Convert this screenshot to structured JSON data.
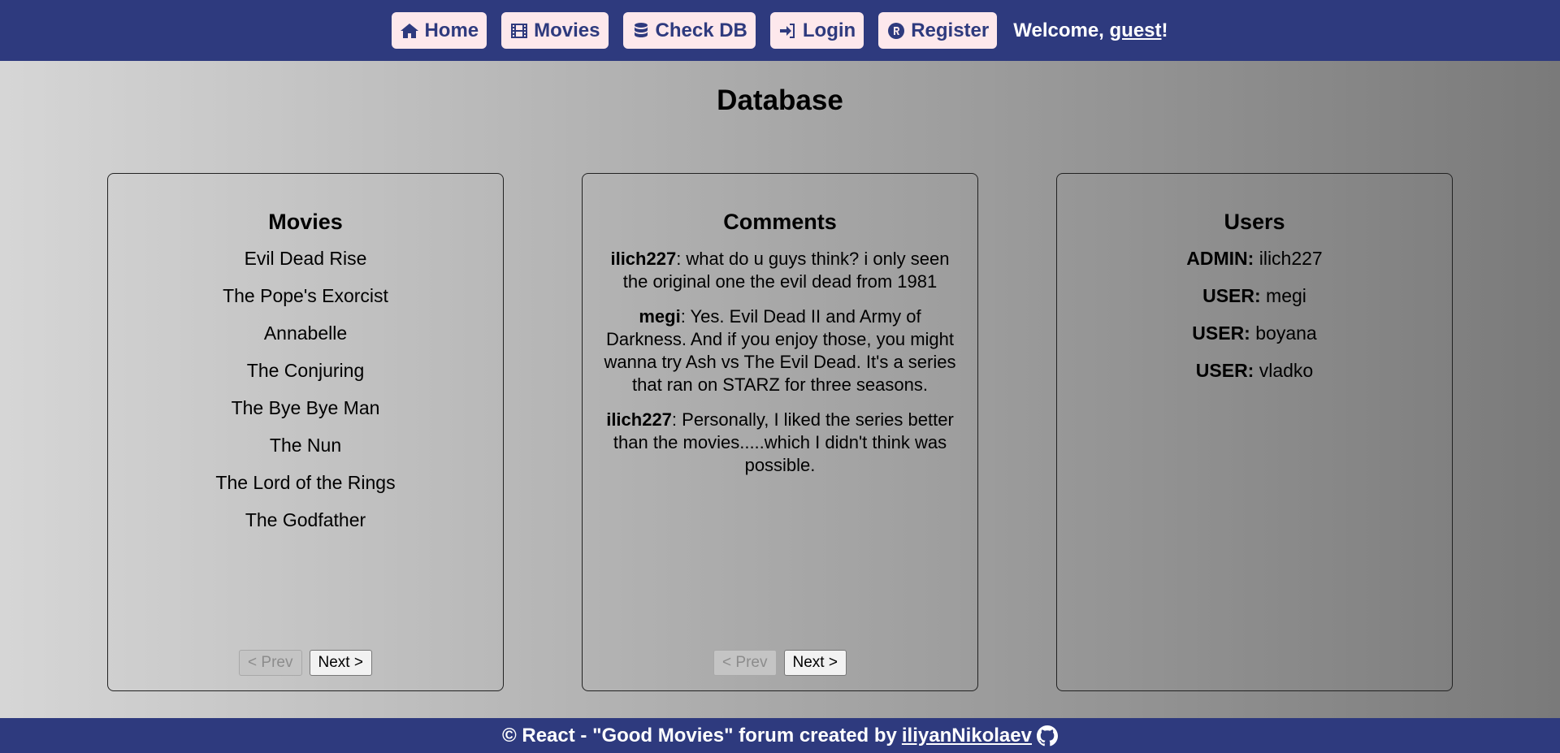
{
  "nav": {
    "home_label": "Home",
    "movies_label": "Movies",
    "checkdb_label": "Check DB",
    "login_label": "Login",
    "register_label": "Register",
    "welcome_prefix": "Welcome, ",
    "welcome_user": "guest",
    "welcome_suffix": "!"
  },
  "page": {
    "title": "Database"
  },
  "movies": {
    "heading": "Movies",
    "items": [
      "Evil Dead Rise",
      "The Pope's Exorcist",
      "Annabelle",
      "The Conjuring",
      "The Bye Bye Man",
      "The Nun",
      "The Lord of the Rings",
      "The Godfather"
    ],
    "prev_label": "< Prev",
    "next_label": "Next >"
  },
  "comments": {
    "heading": "Comments",
    "items": [
      {
        "author": "ilich227",
        "text": ": what do u guys think? i only seen the original one the evil dead from 1981"
      },
      {
        "author": "megi",
        "text": ": Yes. Evil Dead II and Army of Darkness. And if you enjoy those, you might wanna try Ash vs The Evil Dead. It's a series that ran on STARZ for three seasons."
      },
      {
        "author": "ilich227",
        "text": ": Personally, I liked the series better than the movies.....which I didn't think was possible."
      }
    ],
    "prev_label": "< Prev",
    "next_label": "Next >"
  },
  "users": {
    "heading": "Users",
    "items": [
      {
        "role": "ADMIN:",
        "name": " ilich227"
      },
      {
        "role": "USER:",
        "name": " megi"
      },
      {
        "role": "USER:",
        "name": " boyana"
      },
      {
        "role": "USER:",
        "name": " vladko"
      }
    ]
  },
  "footer": {
    "text": "© React - \"Good Movies\" forum created by",
    "author_link": "iliyanNikolaev"
  },
  "colors": {
    "navbar": "#2e3a7e",
    "nav_button_bg": "#fde8ec",
    "nav_button_text": "#2e3a7e"
  },
  "icons": {
    "home": "home-icon",
    "movies": "film-icon",
    "checkdb": "database-icon",
    "login": "sign-in-icon",
    "register": "registered-icon",
    "footer": "github-icon"
  }
}
